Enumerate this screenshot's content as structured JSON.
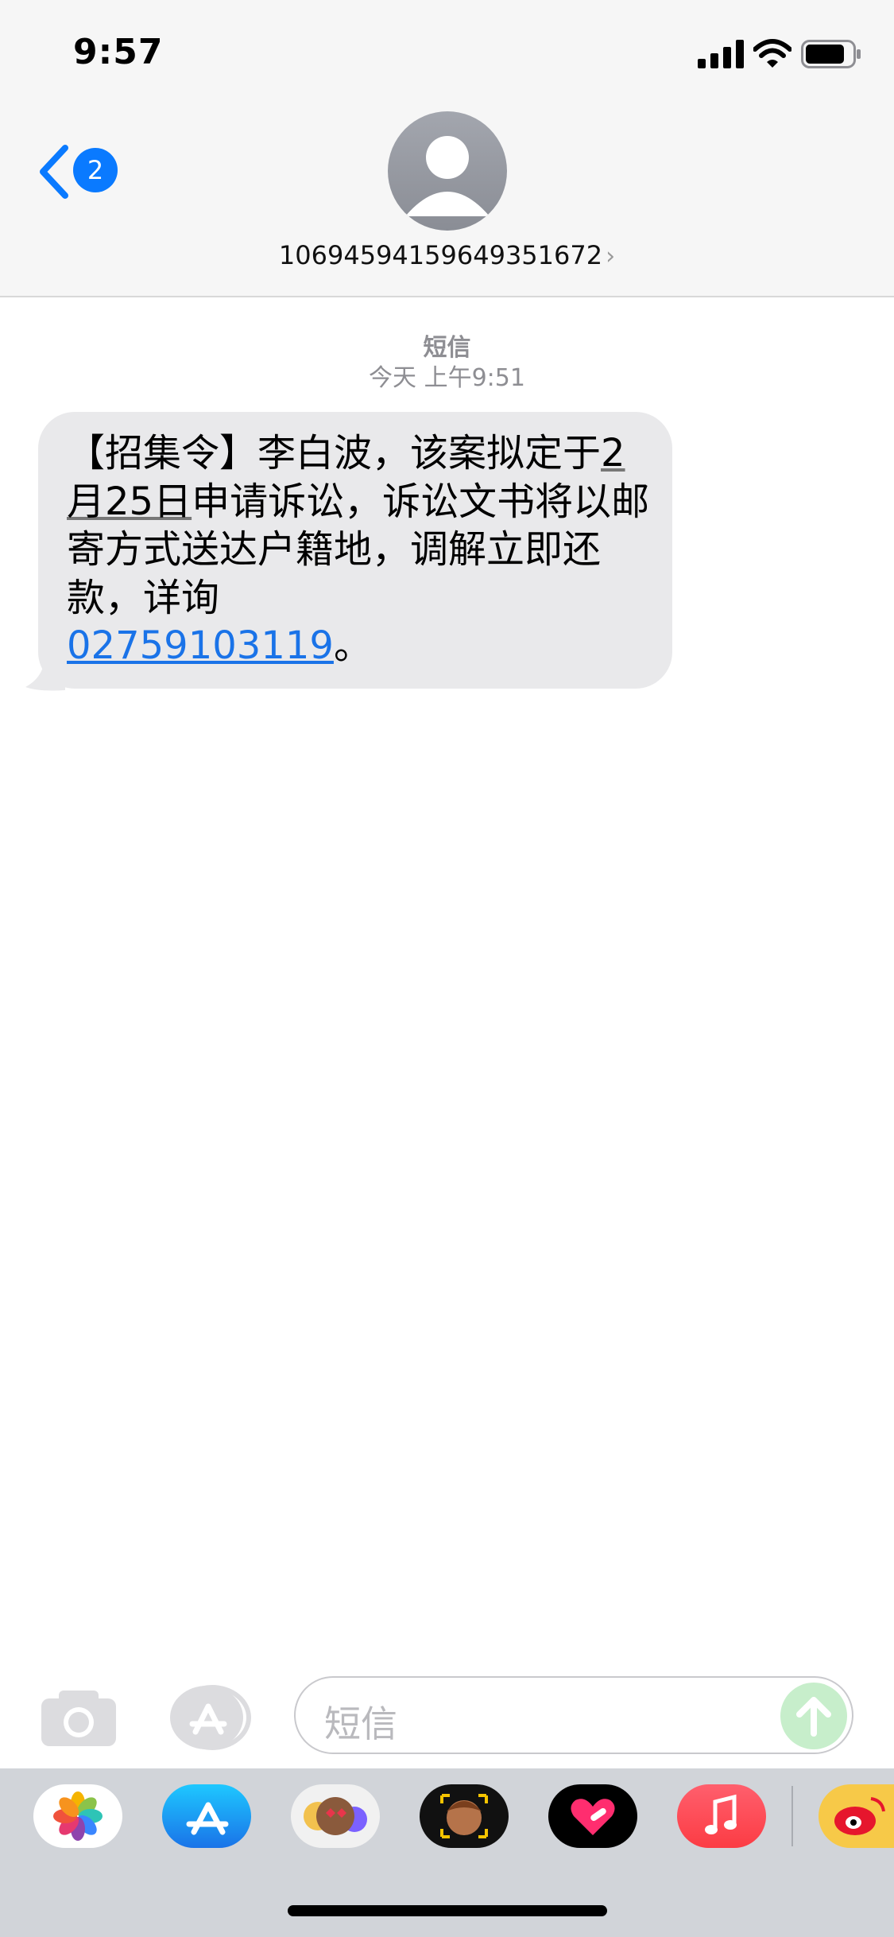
{
  "status_bar": {
    "time": "9:57"
  },
  "header": {
    "back_badge": "2",
    "contact_name": "10694594159649351672",
    "chevron": "›"
  },
  "thread": {
    "service_label": "短信",
    "timestamp": "今天 上午9:51",
    "message": {
      "part1": "【招集令】李白波，该案拟定于",
      "date": "2月25日",
      "part2": "申请诉讼，诉讼文书将以邮寄方式送达户籍地，调解立即还款，详询",
      "phone": "02759103119",
      "part3": "。"
    }
  },
  "composer": {
    "placeholder": "短信"
  },
  "app_strip": {
    "apps": [
      "photos-app-icon",
      "app-store-icon",
      "memoji-stickers-icon",
      "animoji-icon",
      "digital-touch-icon",
      "music-app-icon",
      "weibo-app-icon"
    ]
  },
  "colors": {
    "accent": "#0a7aff",
    "bubble": "#e9e9eb",
    "link": "#1a73e8",
    "send_disabled": "#c7eecb"
  }
}
